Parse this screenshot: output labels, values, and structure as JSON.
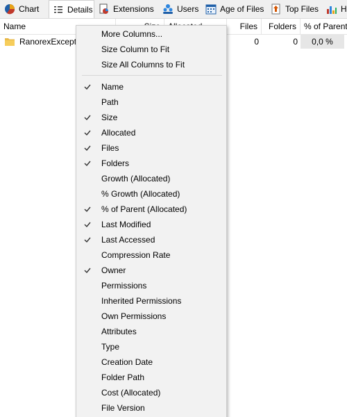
{
  "tabs": [
    {
      "label": "Chart",
      "icon": "pie-chart-icon"
    },
    {
      "label": "Details",
      "icon": "details-list-icon",
      "active": true
    },
    {
      "label": "Extensions",
      "icon": "extensions-icon"
    },
    {
      "label": "Users",
      "icon": "users-icon"
    },
    {
      "label": "Age of Files",
      "icon": "calendar-icon"
    },
    {
      "label": "Top Files",
      "icon": "top-files-icon"
    },
    {
      "label": "H",
      "icon": "history-chart-icon"
    }
  ],
  "columns": {
    "name": "Name",
    "size": "Size",
    "allocated": "Allocated",
    "files": "Files",
    "folders": "Folders",
    "pct_parent": "% of Parent"
  },
  "rows": [
    {
      "name": "RanorexExceptions",
      "files": "0",
      "folders": "0",
      "pct_parent": "0,0 %",
      "icon": "folder-icon"
    }
  ],
  "menu": {
    "top_items": [
      "More Columns...",
      "Size Column to Fit",
      "Size All Columns to Fit"
    ],
    "columns": [
      {
        "label": "Name",
        "checked": true
      },
      {
        "label": "Path",
        "checked": false
      },
      {
        "label": "Size",
        "checked": true
      },
      {
        "label": "Allocated",
        "checked": true
      },
      {
        "label": "Files",
        "checked": true
      },
      {
        "label": "Folders",
        "checked": true
      },
      {
        "label": "Growth (Allocated)",
        "checked": false
      },
      {
        "label": "% Growth (Allocated)",
        "checked": false
      },
      {
        "label": "% of Parent (Allocated)",
        "checked": true
      },
      {
        "label": "Last Modified",
        "checked": true
      },
      {
        "label": "Last Accessed",
        "checked": true
      },
      {
        "label": "Compression Rate",
        "checked": false
      },
      {
        "label": "Owner",
        "checked": true
      },
      {
        "label": "Permissions",
        "checked": false
      },
      {
        "label": "Inherited Permissions",
        "checked": false
      },
      {
        "label": "Own Permissions",
        "checked": false
      },
      {
        "label": "Attributes",
        "checked": false
      },
      {
        "label": "Type",
        "checked": false
      },
      {
        "label": "Creation Date",
        "checked": false
      },
      {
        "label": "Folder Path",
        "checked": false
      },
      {
        "label": "Cost (Allocated)",
        "checked": false
      },
      {
        "label": "File Version",
        "checked": false
      }
    ]
  }
}
